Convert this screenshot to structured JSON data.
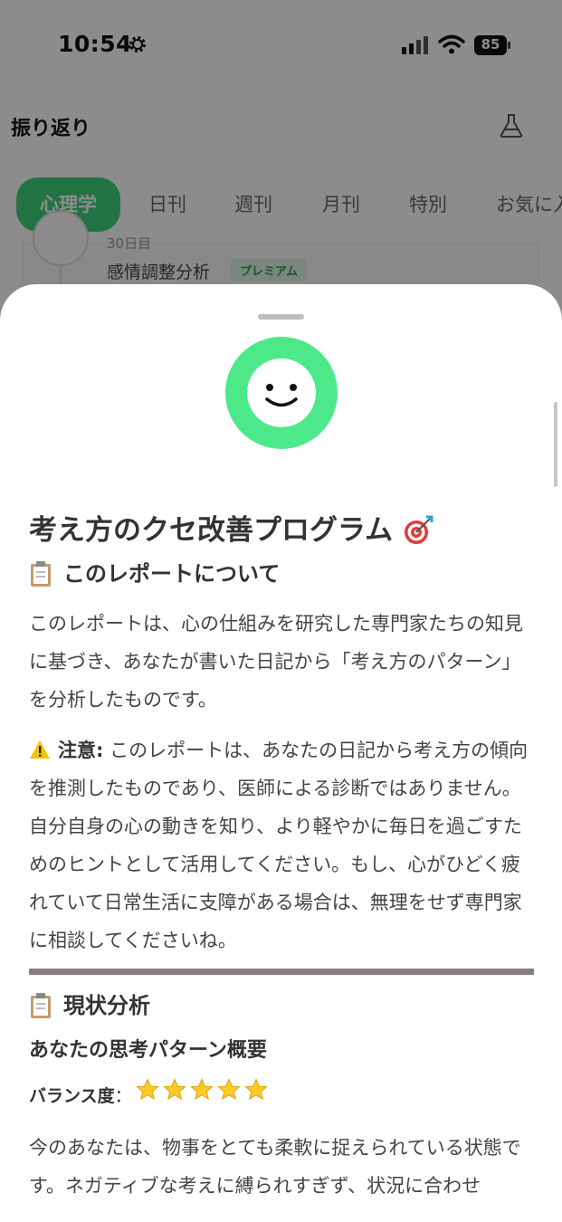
{
  "status_bar": {
    "time": "10:54",
    "battery": "85"
  },
  "header": {
    "title": "振り返り"
  },
  "tabs": [
    {
      "label": "心理学",
      "active": true
    },
    {
      "label": "日刊",
      "active": false
    },
    {
      "label": "週刊",
      "active": false
    },
    {
      "label": "月刊",
      "active": false
    },
    {
      "label": "特別",
      "active": false
    },
    {
      "label": "お気に入",
      "active": false
    }
  ],
  "behind_item": {
    "date": "30日目",
    "label": "感情調整分析",
    "badge": "プレミアム"
  },
  "report": {
    "title": "考え方のクセ改善プログラム",
    "about_heading": "このレポートについて",
    "about_text": "このレポートは、心の仕組みを研究した専門家たちの知見に基づき、あなたが書いた日記から「考え方のパターン」を分析したものです。",
    "warning_label": "注意:",
    "warning_text": " このレポートは、あなたの日記から考え方の傾向を推測したものであり、医師による診断ではありません。自分自身の心の動きを知り、より軽やかに毎日を過ごすためのヒントとして活用してください。もし、心がひどく疲れていて日常生活に支障がある場合は、無理をせず専門家に相談してくださいね。",
    "analysis_heading": "現状分析",
    "overview_heading": "あなたの思考パターン概要",
    "balance_label": "バランス度",
    "balance_sep": "：",
    "balance_stars": 5,
    "overview_text": "今のあなたは、物事をとても柔軟に捉えられている状態です。ネガティブな考えに縛られすぎず、状況に合わせ"
  },
  "colors": {
    "accent": "#3fd27a",
    "mascot": "#4ce88a",
    "divider": "#8a7d7d"
  }
}
